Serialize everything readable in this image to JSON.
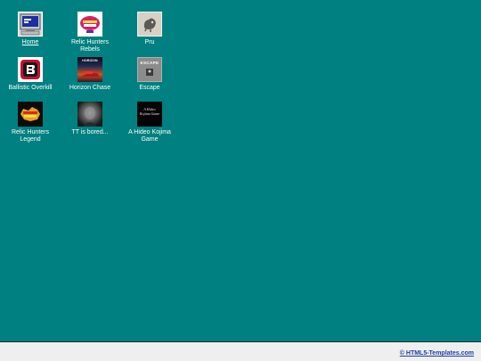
{
  "desktop": {
    "background": "#008080",
    "icons": [
      {
        "label": "Home",
        "icon": "computer-icon"
      },
      {
        "label": "Relic Hunters Rebels",
        "icon": "relic-hunters-rebels-logo-icon"
      },
      {
        "label": "Pru",
        "icon": "pru-creature-icon"
      },
      {
        "label": "Ballistic Overkill",
        "icon": "ballistic-overkill-logo-icon"
      },
      {
        "label": "Horizon Chase",
        "icon": "horizon-chase-cover-icon"
      },
      {
        "label": "Escape",
        "icon": "escape-icon"
      },
      {
        "label": "Relic Hunters Legend",
        "icon": "relic-hunters-legend-logo-icon"
      },
      {
        "label": "TT is bored...",
        "icon": "tt-portrait-icon"
      },
      {
        "label": "A Hideo Kojima Game",
        "icon": "hideo-kojima-icon"
      }
    ],
    "icon_text": {
      "horizon_chase": "HORIZON",
      "escape": "ESCAPE",
      "hideo_kojima": "A Hideo Kojima Game"
    }
  },
  "taskbar": {
    "credit_link": "© HTML5-Templates.com",
    "background": "#efefef",
    "link_color": "#1a3fa8"
  }
}
